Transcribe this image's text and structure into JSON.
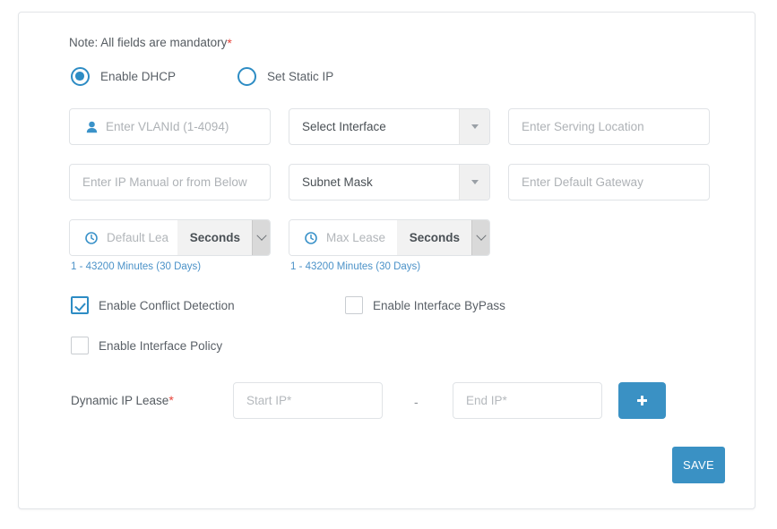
{
  "note": {
    "text": "Note: All fields are mandatory",
    "required_marker": "*"
  },
  "mode_options": [
    {
      "label": "Enable DHCP",
      "selected": true
    },
    {
      "label": "Set Static IP",
      "selected": false
    }
  ],
  "fields": {
    "vlan_id": {
      "placeholder": "Enter VLANId (1-4094)",
      "value": "",
      "icon": "user-icon"
    },
    "interface_select": {
      "selected": "Select Interface",
      "caret_icon": "chevron-down-icon"
    },
    "serving_location": {
      "placeholder": "Enter Serving Location",
      "value": ""
    },
    "ip_manual": {
      "placeholder": "Enter IP Manual or from Below",
      "value": ""
    },
    "subnet_mask_select": {
      "selected": "Subnet Mask",
      "caret_icon": "chevron-down-icon"
    },
    "default_gateway": {
      "placeholder": "Enter Default Gateway",
      "value": ""
    },
    "default_lease": {
      "placeholder": "Default Lea",
      "value": "",
      "icon": "clock-icon",
      "unit": "Seconds",
      "help": "1 - 43200 Minutes (30 Days)"
    },
    "max_lease": {
      "placeholder": "Max Lease",
      "value": "",
      "icon": "clock-icon",
      "unit": "Seconds",
      "help": "1 - 43200 Minutes (30 Days)"
    }
  },
  "checkboxes": [
    {
      "label": "Enable Conflict Detection",
      "checked": true
    },
    {
      "label": "Enable Interface ByPass",
      "checked": false
    },
    {
      "label": "Enable Interface Policy",
      "checked": false
    }
  ],
  "dynamic_ip_lease": {
    "label": "Dynamic IP Lease",
    "required_marker": "*",
    "start_placeholder": "Start IP*",
    "start_value": "",
    "separator": "-",
    "end_placeholder": "End IP*",
    "end_value": "",
    "add_button_icon": "plus-icon"
  },
  "actions": {
    "save_label": "SAVE"
  },
  "colors": {
    "accent_blue": "#3a91c4",
    "control_blue": "#2d8cc4",
    "help_blue": "#4b92c8",
    "required_red": "#e8433a",
    "border_gray": "#e0e3e6"
  }
}
